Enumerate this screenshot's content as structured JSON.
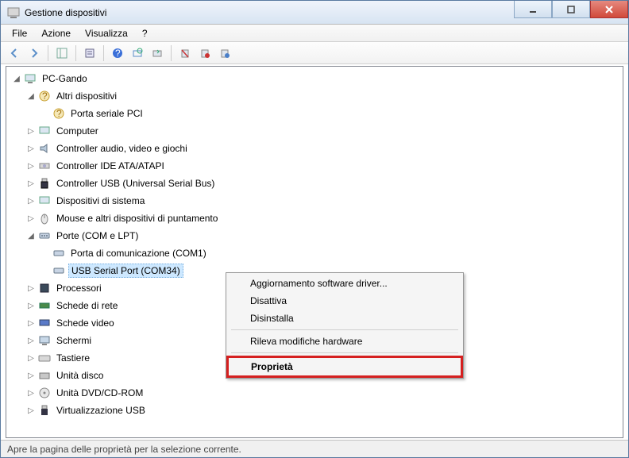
{
  "window": {
    "title": "Gestione dispositivi"
  },
  "menu": {
    "file": "File",
    "action": "Azione",
    "view": "Visualizza",
    "help": "?"
  },
  "tree": {
    "root": "PC-Gando",
    "other_devices": "Altri dispositivi",
    "pci_serial": "Porta seriale PCI",
    "computer": "Computer",
    "audio": "Controller audio, video e giochi",
    "ide": "Controller IDE ATA/ATAPI",
    "usb": "Controller USB (Universal Serial Bus)",
    "system": "Dispositivi di sistema",
    "pointing": "Mouse e altri dispositivi di puntamento",
    "ports": "Porte (COM e LPT)",
    "com1": "Porta di comunicazione (COM1)",
    "usb_serial": "USB Serial Port (COM34)",
    "cpu": "Processori",
    "nic": "Schede di rete",
    "gpu": "Schede video",
    "monitor": "Schermi",
    "keyboard": "Tastiere",
    "disk": "Unità disco",
    "dvd": "Unità DVD/CD-ROM",
    "vusb": "Virtualizzazione USB"
  },
  "context": {
    "update": "Aggiornamento software driver...",
    "disable": "Disattiva",
    "uninstall": "Disinstalla",
    "scan": "Rileva modifiche hardware",
    "properties": "Proprietà"
  },
  "status": "Apre la pagina delle proprietà per la selezione corrente."
}
